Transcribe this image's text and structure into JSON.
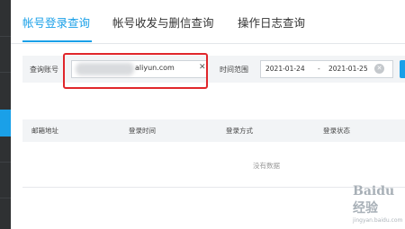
{
  "tabs": [
    {
      "label": "帐号登录查询",
      "active": true
    },
    {
      "label": "帐号收发与删信查询",
      "active": false
    },
    {
      "label": "操作日志查询",
      "active": false
    }
  ],
  "filter": {
    "account_label": "查询账号",
    "account_value": "aliyun.com",
    "time_label": "时间范围",
    "date_start": "2021-01-24",
    "date_separator": "-",
    "date_end": "2021-01-25"
  },
  "table": {
    "headers": [
      "邮箱地址",
      "登录时间",
      "登录方式",
      "登录状态"
    ],
    "empty_text": "没有数据"
  },
  "watermark": {
    "logo": "Baidu经验",
    "sub": "jingyan.baidu.com"
  },
  "colors": {
    "accent": "#1aa0e8",
    "highlight_box": "#e0262b",
    "rail": "#2f3133"
  }
}
